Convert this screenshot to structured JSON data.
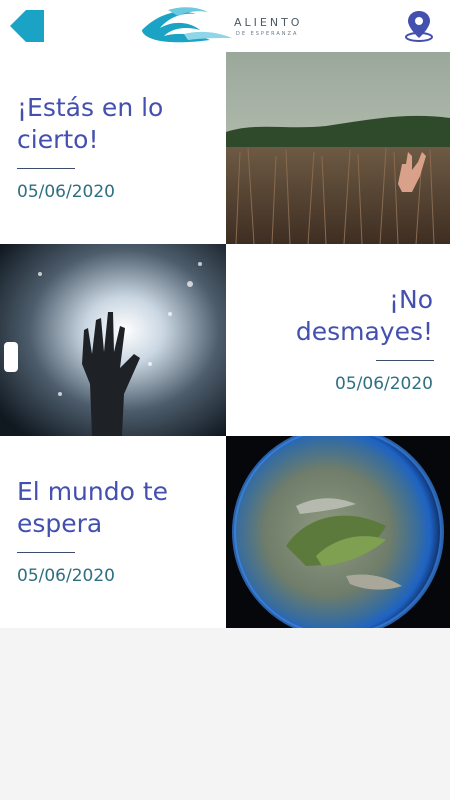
{
  "header": {
    "back_icon": "back-arrow-icon",
    "logo_title": "ALIENTO",
    "logo_subtitle": "DE ESPERANZA",
    "map_icon": "map-pin-icon",
    "accent": "#1aa3c4",
    "brand_blue": "#4450b0"
  },
  "posts": [
    {
      "title_lines": [
        "¡Estás en lo",
        "cierto!"
      ],
      "date": "05/06/2020",
      "image": "hand-in-field-photo"
    },
    {
      "title_lines": [
        "¡No",
        "desmayes!"
      ],
      "date": "05/06/2020",
      "image": "hand-against-light-photo"
    },
    {
      "title_lines": [
        "El mundo te",
        "espera"
      ],
      "date": "05/06/2020",
      "image": "earth-globe-photo"
    }
  ]
}
